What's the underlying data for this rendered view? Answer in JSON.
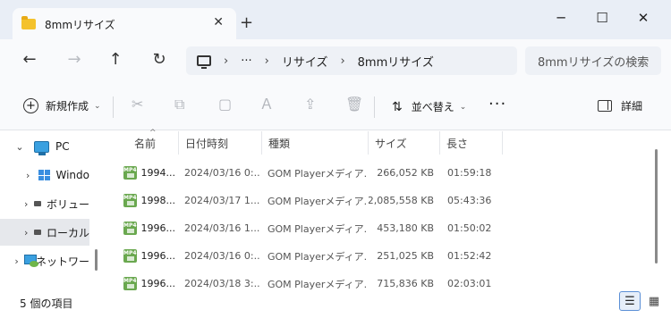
{
  "window": {
    "tab_title": "8mmリサイズ",
    "tab_close": "✕",
    "new_tab": "+",
    "minimize": "─",
    "maximize": "☐",
    "close": "✕"
  },
  "nav": {
    "back": "←",
    "forward": "→",
    "up": "↑",
    "refresh": "↻"
  },
  "address": {
    "ellipsis": "···",
    "sep": "›",
    "crumbs": [
      "リサイズ",
      "8mmリサイズ"
    ],
    "search_placeholder": "8mmリサイズの検索"
  },
  "toolbar": {
    "new_label": "新規作成",
    "new_icon": "+",
    "caret": "⌄",
    "cut_icon": "✂",
    "copy_icon": "⧉",
    "paste_icon": "▢",
    "rename_icon": "Ａ",
    "share_icon": "⇪",
    "delete_icon": "🗑",
    "sort_icon": "⇅",
    "sort_label": "並べ替え",
    "more": "···",
    "details_label": "詳細"
  },
  "sidebar": {
    "items": [
      {
        "label": "PC",
        "chev": "⌄"
      },
      {
        "label": "Windo",
        "chev": "›"
      },
      {
        "label": "ボリュー",
        "chev": "›"
      },
      {
        "label": "ローカル",
        "chev": "›"
      },
      {
        "label": "ネットワー",
        "chev": "›"
      }
    ]
  },
  "columns": {
    "name": "名前",
    "date": "日付時刻",
    "type": "種類",
    "size": "サイズ",
    "length": "長さ",
    "sort_caret": "^"
  },
  "files": [
    {
      "icon": "MP4",
      "name": "1994...",
      "date": "2024/03/16 0:...",
      "type": "GOM Playerメディア...",
      "size": "266,052 KB",
      "length": "01:59:18"
    },
    {
      "icon": "MP4",
      "name": "1998...",
      "date": "2024/03/17 1...",
      "type": "GOM Playerメディア...",
      "size": "2,085,558 KB",
      "length": "05:43:36"
    },
    {
      "icon": "MP4",
      "name": "1996...",
      "date": "2024/03/16 1...",
      "type": "GOM Playerメディア...",
      "size": "453,180 KB",
      "length": "01:50:02"
    },
    {
      "icon": "MP4",
      "name": "1996...",
      "date": "2024/03/16 0:...",
      "type": "GOM Playerメディア...",
      "size": "251,025 KB",
      "length": "01:52:42"
    },
    {
      "icon": "MP4",
      "name": "1996...",
      "date": "2024/03/18 3:...",
      "type": "GOM Playerメディア...",
      "size": "715,836 KB",
      "length": "02:03:01"
    }
  ],
  "status": {
    "item_count": "5 個の項目",
    "list_view_icon": "☰",
    "tiles_view_icon": "▦"
  }
}
